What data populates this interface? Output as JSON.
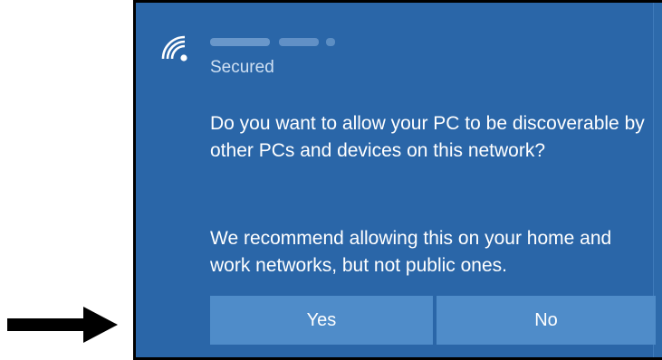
{
  "network": {
    "status": "Secured",
    "icon": "wifi-icon"
  },
  "prompt": {
    "question": "Do you want to allow your PC to be discoverable by other PCs and devices on this network?",
    "recommendation": "We recommend allowing this on your home and work networks, but not public ones."
  },
  "buttons": {
    "yes_label": "Yes",
    "no_label": "No"
  },
  "colors": {
    "panel_bg": "#2a66a8",
    "button_bg": "#4f8cc9",
    "secondary_text": "#cfe0f3",
    "annotation_arrow": "#000000"
  }
}
